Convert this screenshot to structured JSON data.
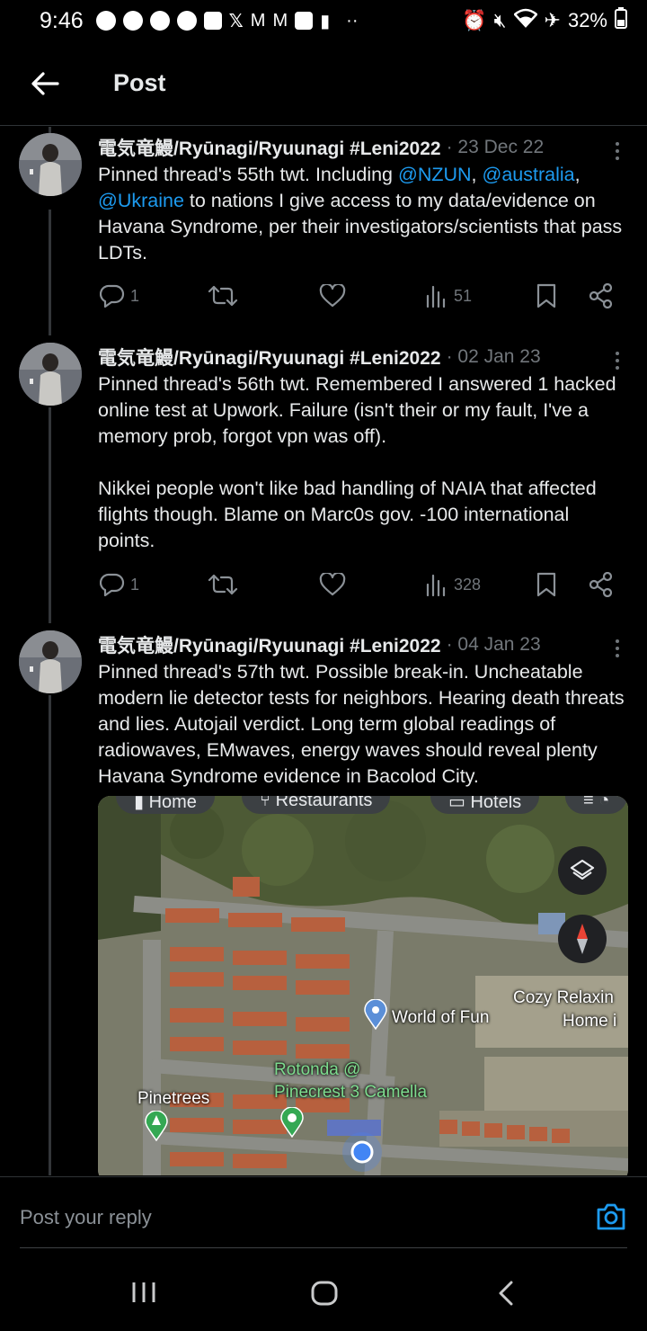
{
  "status_bar": {
    "time": "9:46",
    "battery": "32%",
    "dots": "··"
  },
  "header": {
    "title": "Post",
    "back_icon": "arrow-left-icon"
  },
  "tweets": [
    {
      "name": "電気竜鰻/Ryūnagi/Ryuunagi #Leni2022",
      "date": "· 23 Dec 22",
      "text_parts": [
        "Pinned thread's 55th twt. Including ",
        "@NZUN",
        ", ",
        "@australia",
        ",",
        "@Ukraine",
        " to nations I give access to my data/evidence on Havana Syndrome, per their investigators/scientists that pass LDTs."
      ],
      "replies": "1",
      "views": "51"
    },
    {
      "name": "電気竜鰻/Ryūnagi/Ryuunagi #Leni2022",
      "date": "· 02 Jan 23",
      "paragraphs": [
        "Pinned thread's 56th twt. Remembered I answered 1 hacked online test at Upwork. Failure (isn't their or my fault, I've a memory prob, forgot vpn was off).",
        "Nikkei people won't like bad handling of NAIA that affected flights though. Blame on Marc0s gov. -100 international points."
      ],
      "replies": "1",
      "views": "328"
    },
    {
      "name": "電気竜鰻/Ryūnagi/Ryuunagi #Leni2022",
      "date": "· 04 Jan 23",
      "text": "Pinned thread's 57th twt. Possible break-in. Uncheatable modern lie detector tests for neighbors. Hearing death threats and lies. Autojail verdict. Long term global readings of radiowaves, EMwaves, energy waves should reveal plenty Havana Syndrome evidence in Bacolod City.",
      "map": {
        "chips": [
          "Home",
          "Restaurants",
          "Hotels"
        ],
        "labels": {
          "world_of_fun": "World of Fun",
          "cozy_1": "Cozy Relaxin",
          "cozy_2": "Home i",
          "rotonda_1": "Rotonda @",
          "rotonda_2": "Pinecrest 3 Camella",
          "pinetrees": "Pinetrees"
        }
      }
    }
  ],
  "reply": {
    "placeholder": "Post your reply",
    "camera_icon": "camera-icon"
  },
  "nav": {
    "recents_icon": "recents-icon",
    "home_icon": "home-icon",
    "back_icon": "back-icon"
  },
  "colors": {
    "background": "#000000",
    "text": "#e7e9ea",
    "muted": "#71767b",
    "link": "#1d9bf0",
    "divider": "#2f3336"
  }
}
